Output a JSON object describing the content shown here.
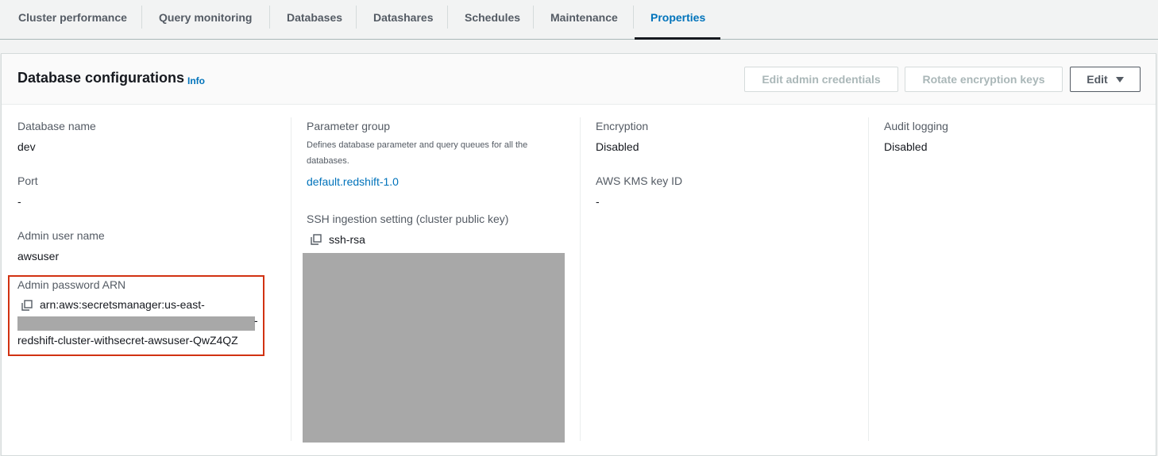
{
  "tabs": [
    {
      "label": "Cluster performance"
    },
    {
      "label": "Query monitoring"
    },
    {
      "label": "Databases"
    },
    {
      "label": "Datashares"
    },
    {
      "label": "Schedules"
    },
    {
      "label": "Maintenance"
    },
    {
      "label": "Properties",
      "active": true
    }
  ],
  "panel": {
    "title": "Database configurations",
    "info": "Info",
    "buttons": {
      "edit_admin_credentials": "Edit admin credentials",
      "rotate_encryption_keys": "Rotate encryption keys",
      "edit": "Edit"
    }
  },
  "fields": {
    "database_name": {
      "label": "Database name",
      "value": "dev"
    },
    "port": {
      "label": "Port",
      "value": "-"
    },
    "admin_user_name": {
      "label": "Admin user name",
      "value": "awsuser"
    },
    "admin_password_arn": {
      "label": "Admin password ARN",
      "value_line1": "arn:aws:secretsmanager:us-east-",
      "value_line1_trail": "-",
      "value_line3": "redshift-cluster-withsecret-awsuser-QwZ4QZ"
    },
    "parameter_group": {
      "label": "Parameter group",
      "description": "Defines database parameter and query queues for all the databases.",
      "value": "default.redshift-1.0"
    },
    "ssh_ingestion": {
      "label": "SSH ingestion setting (cluster public key)",
      "value": "ssh-rsa"
    },
    "encryption": {
      "label": "Encryption",
      "value": "Disabled"
    },
    "kms_key_id": {
      "label": "AWS KMS key ID",
      "value": "-"
    },
    "audit_logging": {
      "label": "Audit logging",
      "value": "Disabled"
    }
  },
  "colors": {
    "accent": "#0073bb",
    "highlight": "#d13212",
    "redaction": "#a8a8a8"
  }
}
